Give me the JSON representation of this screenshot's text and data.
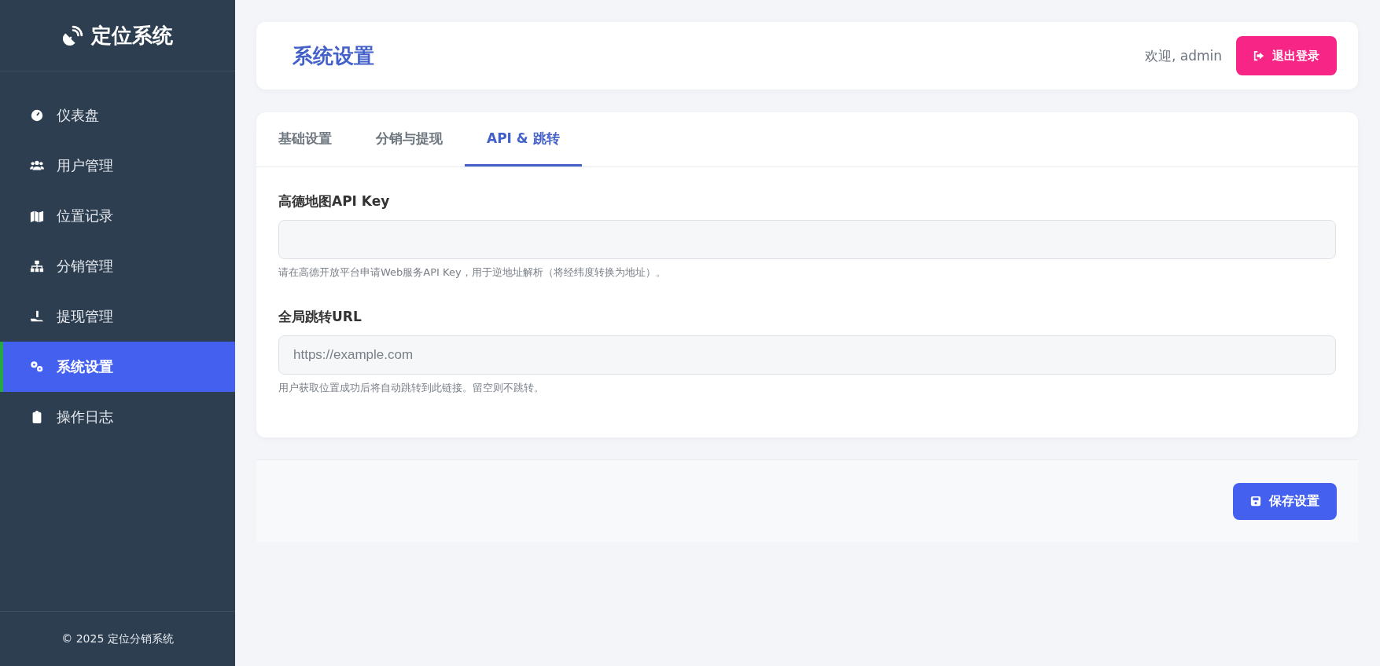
{
  "sidebar": {
    "brand": "定位系统",
    "items": [
      {
        "label": "仪表盘",
        "selected": false
      },
      {
        "label": "用户管理",
        "selected": false
      },
      {
        "label": "位置记录",
        "selected": false
      },
      {
        "label": "分销管理",
        "selected": false
      },
      {
        "label": "提现管理",
        "selected": false
      },
      {
        "label": "系统设置",
        "selected": true
      },
      {
        "label": "操作日志",
        "selected": false
      }
    ],
    "footer": "© 2025 定位分销系统"
  },
  "header": {
    "title": "系统设置",
    "welcome": "欢迎, admin",
    "logout": "退出登录"
  },
  "tabs": [
    {
      "label": "基础设置",
      "selected": false
    },
    {
      "label": "分销与提现",
      "selected": false
    },
    {
      "label": "API & 跳转",
      "selected": true
    }
  ],
  "fields": [
    {
      "label": "高德地图API Key",
      "help": "请在高德开放平台申请Web服务API Key，用于逆地址解析（将经纬度转换为地址）。"
    },
    {
      "label": "全局跳转URL",
      "placeholder": "https://example.com",
      "help": "用户获取位置成功后将自动跳转到此链接。留空则不跳转。"
    }
  ],
  "save_button": "保存设置"
}
